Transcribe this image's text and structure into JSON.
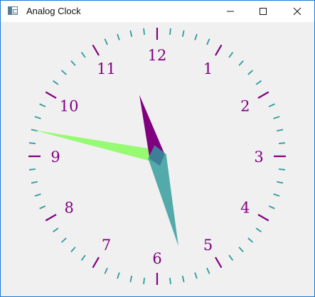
{
  "window": {
    "title": "Analog Clock",
    "controls": {
      "minimize_icon": "minimize-icon",
      "maximize_icon": "maximize-icon",
      "close_icon": "close-icon"
    }
  },
  "clock": {
    "numerals": [
      "12",
      "1",
      "2",
      "3",
      "4",
      "5",
      "6",
      "7",
      "8",
      "9",
      "10",
      "11"
    ],
    "time": {
      "hour": 11,
      "minute": 27,
      "second": 47
    },
    "colors": {
      "numerals": "#800080",
      "hour_ticks": "#800080",
      "minute_ticks": "#2f9a9b",
      "hour_hand": "#800080",
      "minute_hand": "#2f9a9b",
      "second_hand": "#7cfc50"
    }
  }
}
